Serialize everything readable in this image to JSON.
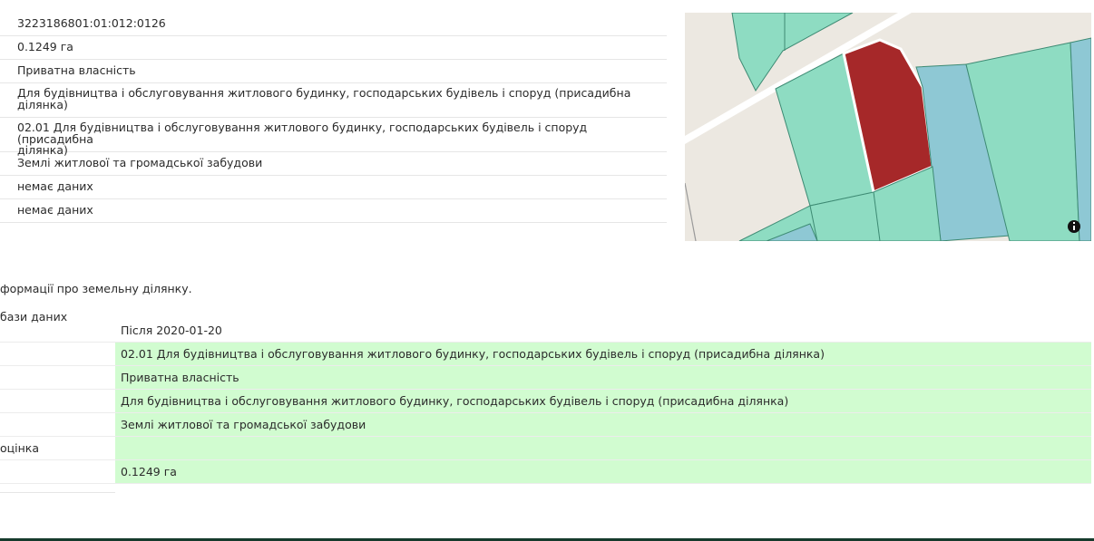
{
  "parcel": {
    "rows": [
      {
        "value": "3223186801:01:012:0126",
        "lines": 1
      },
      {
        "value": "0.1249 га",
        "lines": 1
      },
      {
        "value": "Приватна власність",
        "lines": 1
      },
      {
        "line1": "Для будівництва і обслуговування житлового будинку, господарських будівель і споруд (присадибна",
        "line2": "ділянка)",
        "lines": 2
      },
      {
        "line1": "02.01 Для будівництва і обслуговування житлового будинку, господарських будівель і споруд (присадибна",
        "line2": "ділянка)",
        "lines": 2
      },
      {
        "value": "Землі житлової та громадської забудови",
        "lines": 1
      },
      {
        "value": "немає даних",
        "lines": 1
      },
      {
        "value": "немає даних",
        "lines": 1
      }
    ]
  },
  "map": {
    "colors": {
      "background": "#ece8e1",
      "road": "#ffffff",
      "parcel_green": "#8edcc2",
      "parcel_blue": "#8ec8d4",
      "selected_parcel": "#a62829",
      "parcel_border": "#3d8a73"
    },
    "info_icon": "info-icon"
  },
  "history": {
    "note": "формації про земельну ділянку.",
    "caption": "бази даних",
    "period": "Після 2020-01-20",
    "rows": [
      {
        "label": "",
        "value": "02.01 Для будівництва і обслуговування житлового будинку, господарських будівель і споруд (присадибна ділянка)"
      },
      {
        "label": "",
        "value": "Приватна власність"
      },
      {
        "label": "",
        "value": "Для будівництва і обслуговування житлового будинку, господарських будівель і споруд (присадибна ділянка)"
      },
      {
        "label": "",
        "value": "Землі житлової та громадської забудови"
      },
      {
        "label": "оцінка",
        "value": ""
      },
      {
        "label": "",
        "value": "0.1249 га"
      }
    ],
    "changed_color": "#d1fcd0"
  },
  "footer": {
    "color": "#163a2c"
  }
}
